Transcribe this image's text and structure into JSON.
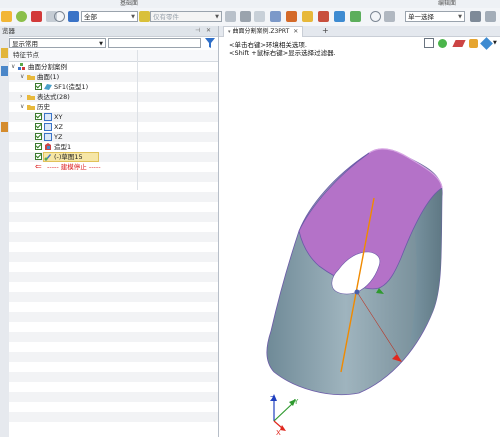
{
  "ribbon": {
    "group1": "基础面",
    "group2": "编辑面"
  },
  "toolbar": {
    "filter_value": "全部",
    "pick_value": "仅有零件",
    "mode_value": "单一选择"
  },
  "panel": {
    "title": "览器",
    "filter_select": "显示常用",
    "filter_input": "",
    "tree_header": "特征节点"
  },
  "tree": {
    "root": "曲面分割案例",
    "surfaces": "曲面(1)",
    "sf1": "SF1(造型1)",
    "expressions": "表达式(28)",
    "history": "历史",
    "xy": "XY",
    "xz": "XZ",
    "yz": "YZ",
    "shape1": "造型1",
    "sketch15": "(-)草图15",
    "rollback": "----- 建模停止 -----"
  },
  "viewport": {
    "tab_label": "曲面分割案例.Z3PRT",
    "tab_add": "+",
    "hint_right": "<单击右键>环境相关选项.",
    "hint_shift": "<Shift +鼠标右键>显示选择过滤器."
  },
  "axes": {
    "x": "X",
    "y": "Y",
    "z": "Z"
  },
  "colors": {
    "surface_top": "#b56fc8",
    "surface_body": "#7f99a6",
    "axis_x": "#e0281e",
    "axis_y": "#2f9a2f",
    "axis_z": "#1f3fbf",
    "datum_line": "#f08a00",
    "rollback": "#d22"
  }
}
